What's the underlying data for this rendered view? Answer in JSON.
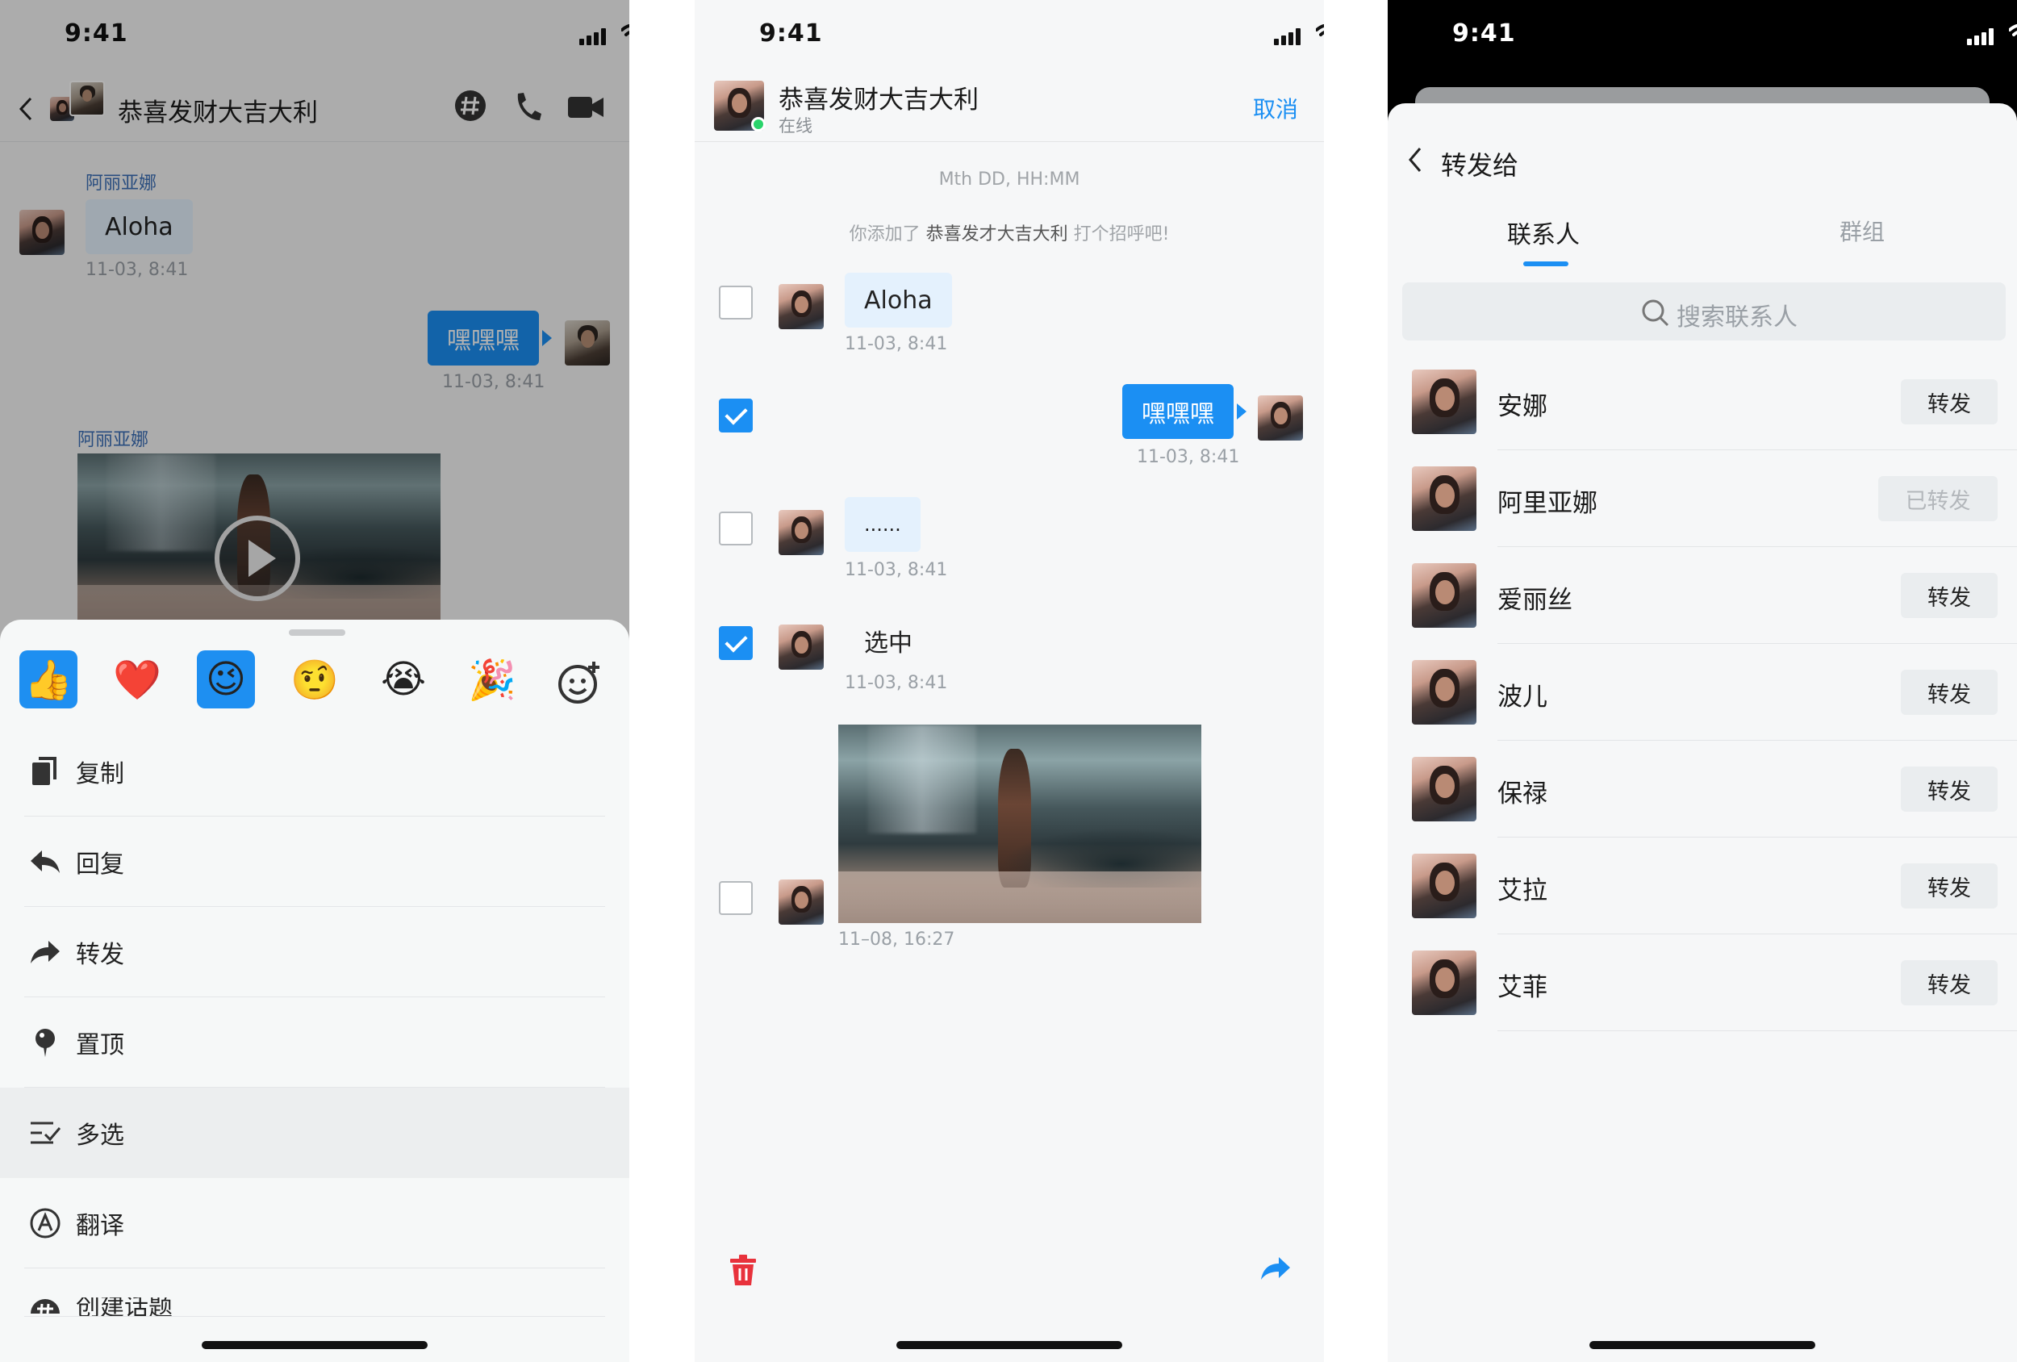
{
  "status": {
    "time": "9:41"
  },
  "screen1": {
    "title": "恭喜发财大吉大利",
    "messages": {
      "sender1": "阿丽亚娜",
      "text1": "Aloha",
      "ts1": "11-03, 8:41",
      "text2": "嘿嘿嘿",
      "ts2": "11-03, 8:41",
      "sender3": "阿丽亚娜"
    },
    "emojis": [
      "👍",
      "❤️",
      "😉",
      "🤨",
      "😭",
      "🎉"
    ],
    "menu": {
      "copy": "复制",
      "reply": "回复",
      "forward": "转发",
      "pin": "置顶",
      "multiselect": "多选",
      "translate": "翻译",
      "topic": "创建话题"
    }
  },
  "screen2": {
    "title": "恭喜发财大吉大利",
    "subtitle": "在线",
    "cancel": "取消",
    "time_placeholder": "Mth DD, HH:MM",
    "notice_pre": "你添加了 ",
    "notice_name": "恭喜发才大吉大利",
    "notice_post": " 打个招呼吧!",
    "messages": [
      {
        "text": "Aloha",
        "ts": "11-03, 8:41",
        "checked": false
      },
      {
        "text": "嘿嘿嘿",
        "ts": "11-03, 8:41",
        "checked": true
      },
      {
        "text": "......",
        "ts": "11-03, 8:41",
        "checked": false
      },
      {
        "text": "选中",
        "ts": "11-03, 8:41",
        "checked": true
      },
      {
        "text": "",
        "ts": "11–08, 16:27",
        "checked": false
      }
    ],
    "colors": {
      "accent": "#1b8ff3",
      "delete": "#e8323c"
    }
  },
  "screen3": {
    "title": "转发给",
    "tabs": {
      "contacts": "联系人",
      "groups": "群组"
    },
    "search_placeholder": "搜索联系人",
    "contacts": [
      {
        "name": "安娜",
        "action": "转发"
      },
      {
        "name": "阿里亚娜",
        "action": "已转发"
      },
      {
        "name": "爱丽丝",
        "action": "转发"
      },
      {
        "name": "波儿",
        "action": "转发"
      },
      {
        "name": "保禄",
        "action": "转发"
      },
      {
        "name": "艾拉",
        "action": "转发"
      },
      {
        "name": "艾菲",
        "action": "转发"
      }
    ]
  }
}
